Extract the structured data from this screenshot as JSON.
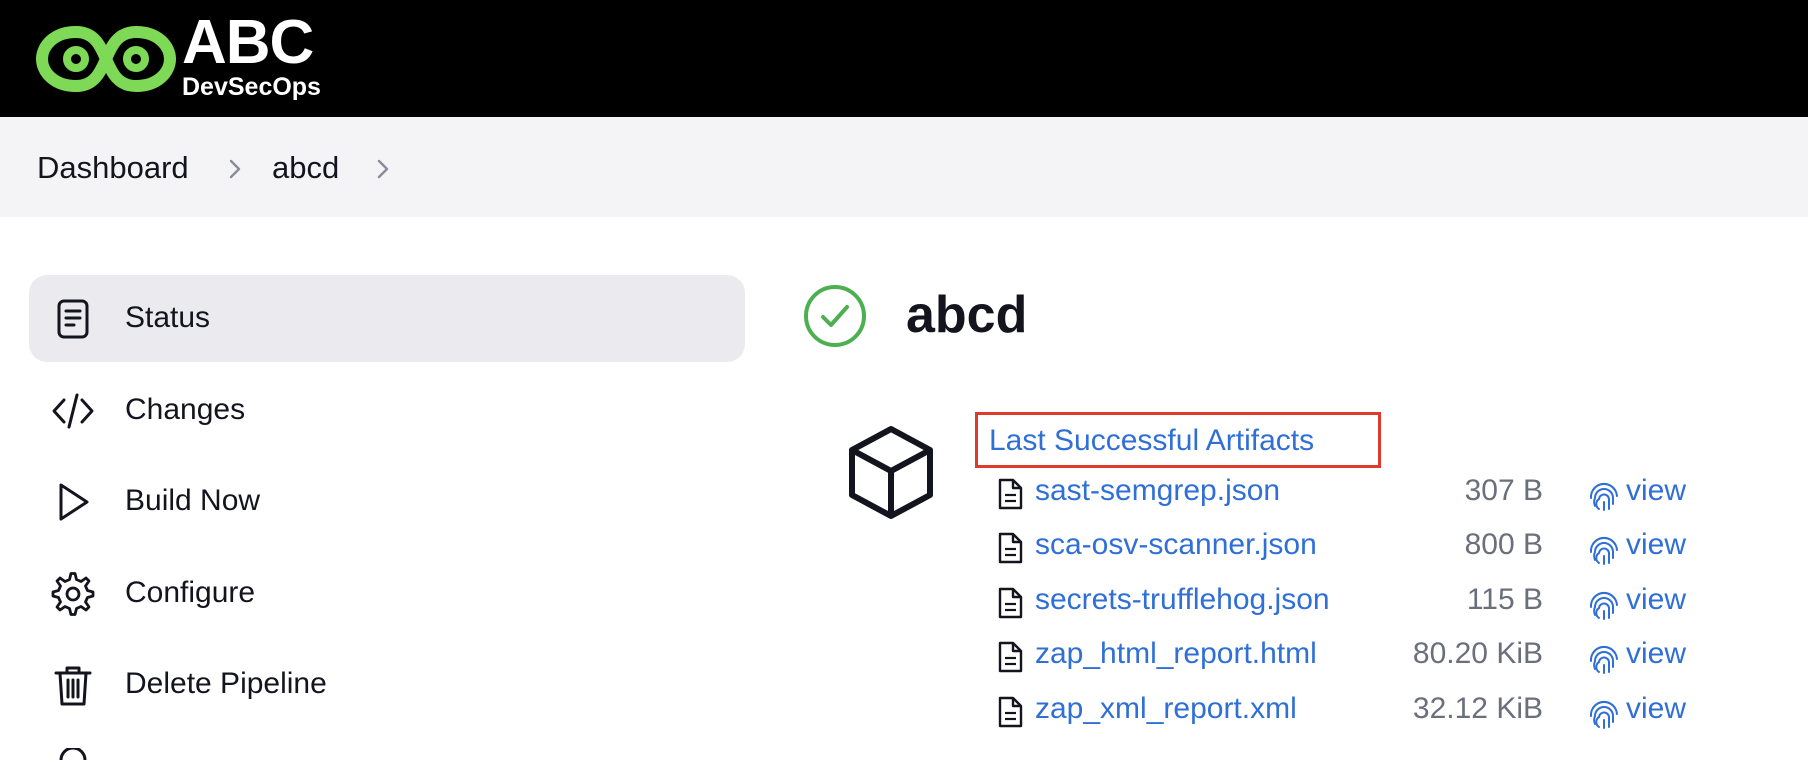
{
  "header": {
    "logo_title": "ABC",
    "logo_subtitle": "DevSecOps",
    "logo_color": "#7ed957"
  },
  "breadcrumb": {
    "items": [
      "Dashboard",
      "abcd"
    ]
  },
  "sidebar": {
    "items": [
      {
        "label": "Status",
        "icon": "status-document-icon",
        "active": true
      },
      {
        "label": "Changes",
        "icon": "code-icon",
        "active": false
      },
      {
        "label": "Build Now",
        "icon": "play-icon",
        "active": false
      },
      {
        "label": "Configure",
        "icon": "gear-icon",
        "active": false
      },
      {
        "label": "Delete Pipeline",
        "icon": "trash-icon",
        "active": false
      }
    ]
  },
  "main": {
    "job_title": "abcd",
    "status": "success",
    "status_color": "#4caf50",
    "artifacts_heading": "Last Successful Artifacts",
    "highlight_color": "#e03a2c",
    "artifacts": [
      {
        "name": "sast-semgrep.json",
        "size": "307 B",
        "action": "view"
      },
      {
        "name": "sca-osv-scanner.json",
        "size": "800 B",
        "action": "view"
      },
      {
        "name": "secrets-trufflehog.json",
        "size": "115 B",
        "action": "view"
      },
      {
        "name": "zap_html_report.html",
        "size": "80.20 KiB",
        "action": "view"
      },
      {
        "name": "zap_xml_report.xml",
        "size": "32.12 KiB",
        "action": "view"
      }
    ]
  }
}
